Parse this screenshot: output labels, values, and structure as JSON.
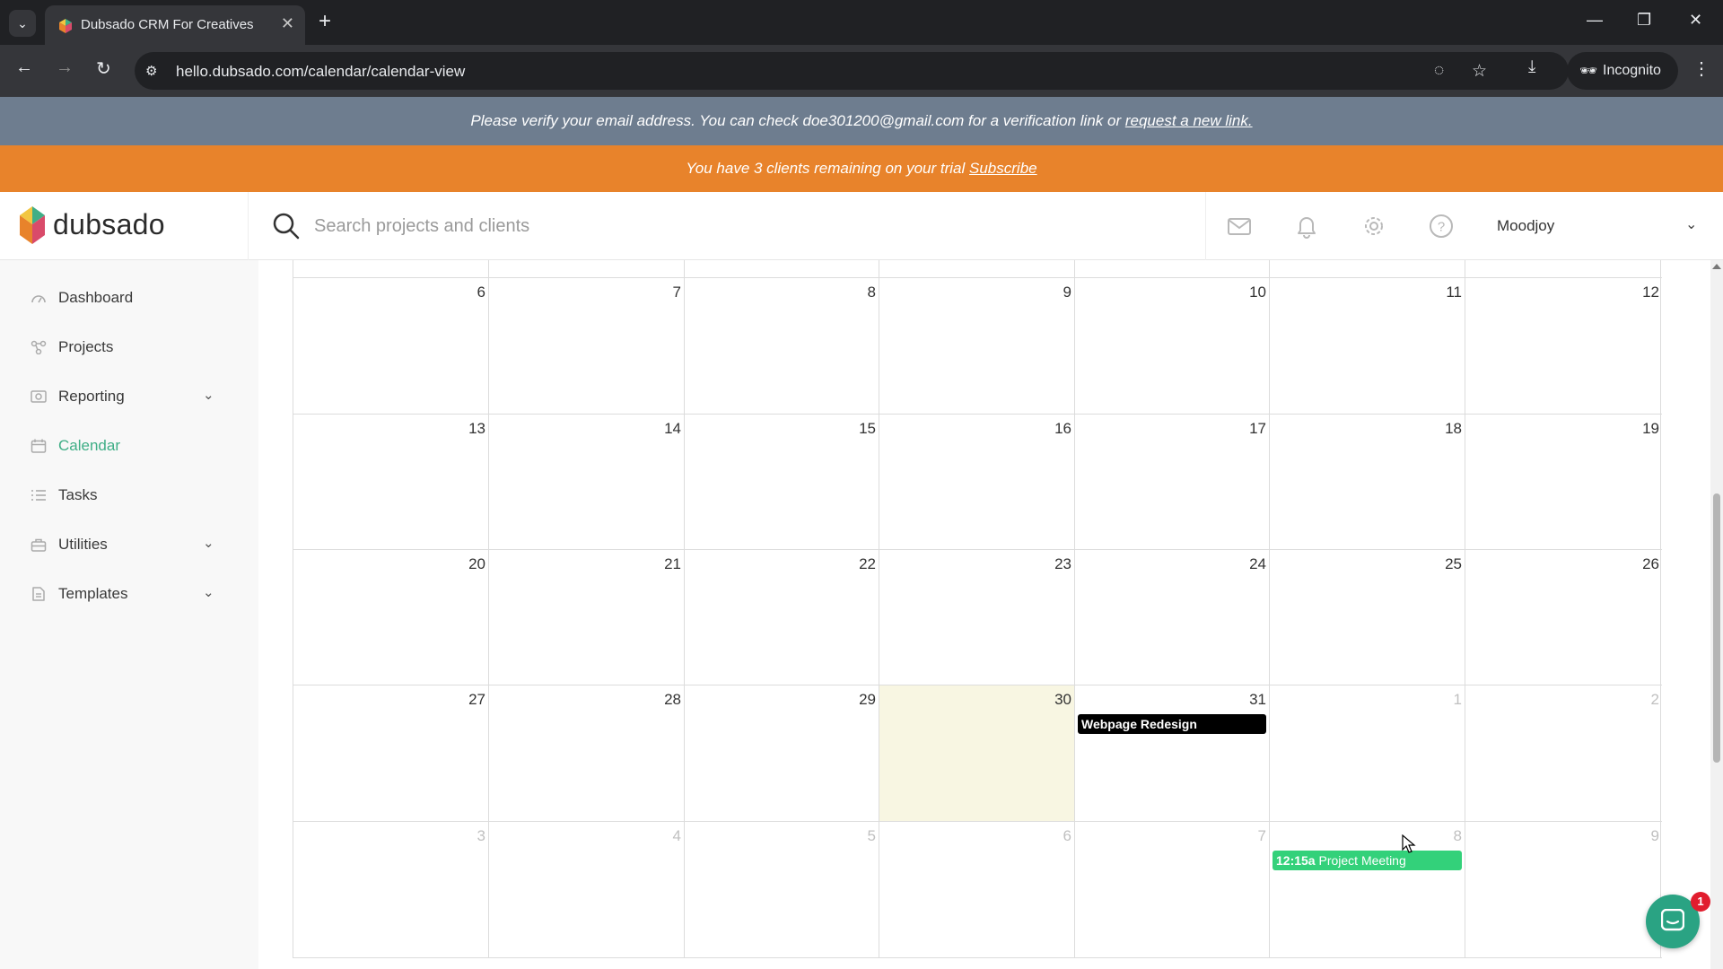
{
  "browser": {
    "tab_title": "Dubsado CRM For Creatives",
    "url": "hello.dubsado.com/calendar/calendar-view",
    "incognito_label": "Incognito"
  },
  "banners": {
    "verify_text": "Please verify your email address. You can check doe301200@gmail.com for a verification link or",
    "verify_link": "request a new link.",
    "trial_text": "You have 3 clients remaining on your trial",
    "trial_link": "Subscribe",
    "verify_color": "#6e7d8f",
    "trial_color": "#e8832b"
  },
  "header": {
    "brand": "dubsado",
    "search_placeholder": "Search projects and clients",
    "user_name": "Moodjoy"
  },
  "sidebar": {
    "accent_color": "#3fae86",
    "items": [
      {
        "label": "Dashboard",
        "icon": "dashboard-icon",
        "active": false,
        "expandable": false
      },
      {
        "label": "Projects",
        "icon": "projects-icon",
        "active": false,
        "expandable": false
      },
      {
        "label": "Reporting",
        "icon": "reporting-icon",
        "active": false,
        "expandable": true
      },
      {
        "label": "Calendar",
        "icon": "calendar-icon",
        "active": true,
        "expandable": false
      },
      {
        "label": "Tasks",
        "icon": "tasks-icon",
        "active": false,
        "expandable": false
      },
      {
        "label": "Utilities",
        "icon": "utilities-icon",
        "active": false,
        "expandable": true
      },
      {
        "label": "Templates",
        "icon": "templates-icon",
        "active": false,
        "expandable": true
      }
    ]
  },
  "calendar": {
    "weeks": [
      [
        {
          "d": "6"
        },
        {
          "d": "7"
        },
        {
          "d": "8"
        },
        {
          "d": "9"
        },
        {
          "d": "10"
        },
        {
          "d": "11"
        },
        {
          "d": "12"
        }
      ],
      [
        {
          "d": "13"
        },
        {
          "d": "14"
        },
        {
          "d": "15"
        },
        {
          "d": "16"
        },
        {
          "d": "17"
        },
        {
          "d": "18"
        },
        {
          "d": "19"
        }
      ],
      [
        {
          "d": "20"
        },
        {
          "d": "21"
        },
        {
          "d": "22"
        },
        {
          "d": "23"
        },
        {
          "d": "24"
        },
        {
          "d": "25"
        },
        {
          "d": "26"
        }
      ],
      [
        {
          "d": "27"
        },
        {
          "d": "28"
        },
        {
          "d": "29"
        },
        {
          "d": "30",
          "today": true
        },
        {
          "d": "31",
          "event": {
            "title": "Webpage Redesign",
            "style": "dark"
          }
        },
        {
          "d": "1",
          "other": true
        },
        {
          "d": "2",
          "other": true
        }
      ],
      [
        {
          "d": "3",
          "other": true
        },
        {
          "d": "4",
          "other": true
        },
        {
          "d": "5",
          "other": true
        },
        {
          "d": "6",
          "other": true
        },
        {
          "d": "7",
          "other": true
        },
        {
          "d": "8",
          "other": true,
          "event": {
            "time": "12:15a",
            "title": "Project Meeting",
            "style": "green"
          }
        },
        {
          "d": "9",
          "other": true
        }
      ]
    ]
  },
  "chat": {
    "badge": "1"
  }
}
